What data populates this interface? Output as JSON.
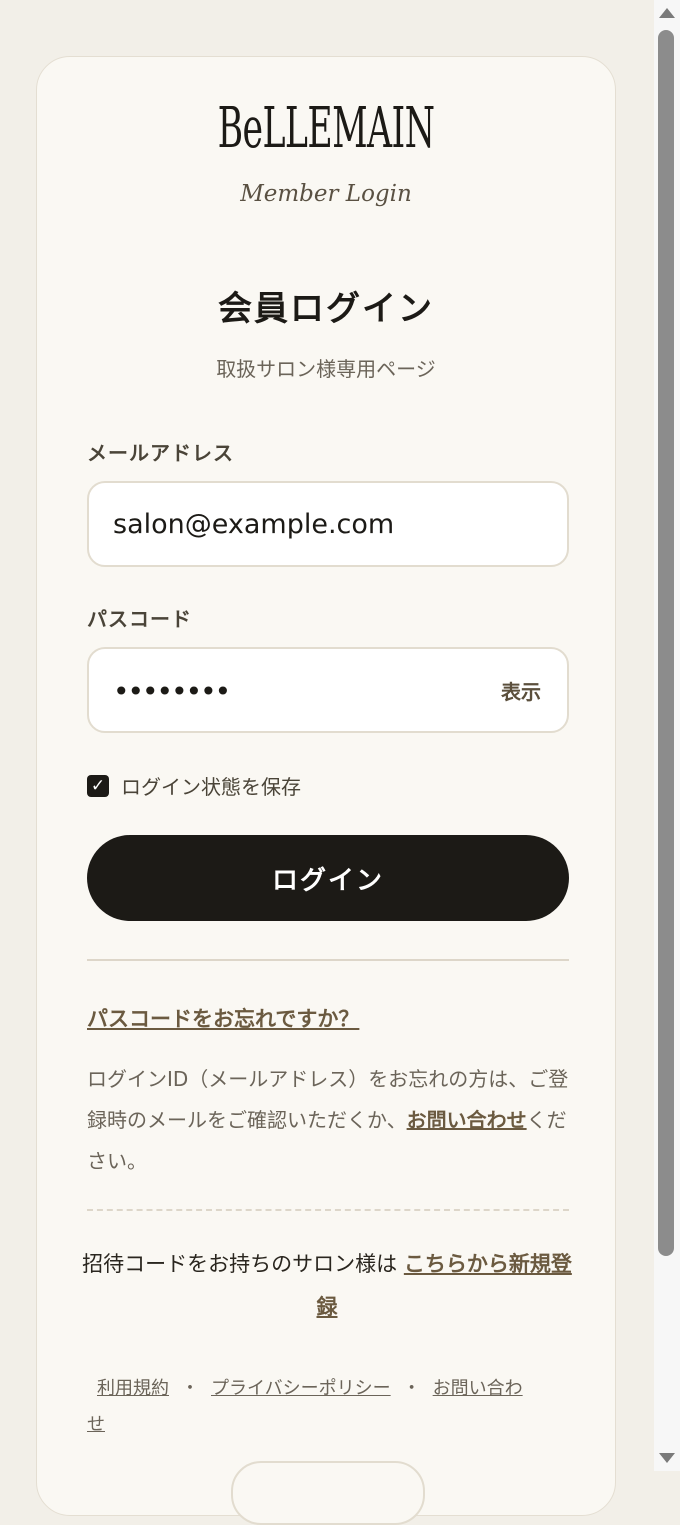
{
  "brand": {
    "logo_text": "BeLLEMAIN",
    "subtitle": "Member Login"
  },
  "header": {
    "title": "会員ログイン",
    "subtitle": "取扱サロン様専用ページ"
  },
  "form": {
    "email_label": "メールアドレス",
    "email_value": "salon@example.com",
    "password_label": "パスコード",
    "password_masked": "••••••••",
    "show_button": "表示",
    "remember_label": "ログイン状態を保存",
    "remember_checked": true,
    "checkbox_glyph": "✓",
    "submit_label": "ログイン"
  },
  "help": {
    "forgot_link": "パスコードをお忘れですか？",
    "note_text": "ログインID（メールアドレス）をお忘れの方は、ご登録時のメールをご確認いただくか、",
    "note_link": "お問い合わせ",
    "note_suffix": "ください。"
  },
  "invite": {
    "text": "招待コードをお持ちのサロン様は",
    "link": "こちらから新規登録"
  },
  "footer": {
    "links": [
      "利用規約",
      "プライバシーポリシー",
      "お問い合わせ"
    ],
    "separator": "・"
  },
  "colors": {
    "page_bg": "#f2efe8",
    "card_bg": "#faf8f3",
    "primary": "#1c1a16",
    "accent_link": "#6b5a40"
  }
}
